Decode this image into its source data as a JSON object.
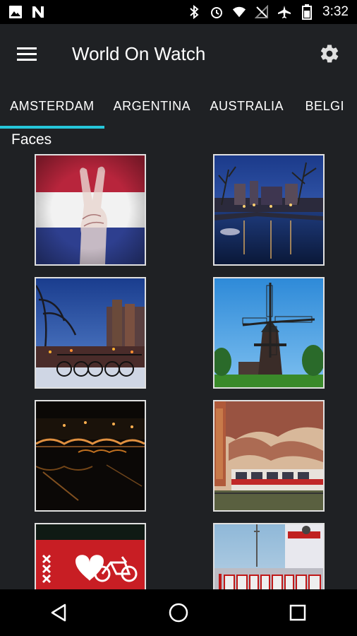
{
  "status_bar": {
    "time": "3:32",
    "icons": [
      "image-icon",
      "n-icon",
      "bluetooth-icon",
      "alarm-icon",
      "wifi-icon",
      "no-signal-icon",
      "airplane-icon",
      "battery-icon"
    ]
  },
  "app_bar": {
    "title": "World On Watch",
    "menu_icon": "hamburger-menu-icon",
    "settings_icon": "gear-icon"
  },
  "tabs": [
    {
      "label": "AMSTERDAM",
      "active": true
    },
    {
      "label": "ARGENTINA",
      "active": false
    },
    {
      "label": "AUSTRALIA",
      "active": false
    },
    {
      "label": "BELGI",
      "active": false
    }
  ],
  "section": {
    "title": "Faces"
  },
  "faces": [
    {
      "name": "netherlands-flag-peace-hand"
    },
    {
      "name": "canal-at-night"
    },
    {
      "name": "bicycles-on-bridge"
    },
    {
      "name": "windmill"
    },
    {
      "name": "bridge-lights-night"
    },
    {
      "name": "train-dramatic-sky"
    },
    {
      "name": "xxx-heart-bicycle"
    },
    {
      "name": "iamsterdam-letters"
    }
  ],
  "nav_bar": {
    "back_icon": "back-triangle-icon",
    "home_icon": "home-circle-icon",
    "recents_icon": "recents-square-icon"
  },
  "colors": {
    "background": "#1f2124",
    "accent": "#26c6da",
    "status_bar": "#000000"
  }
}
